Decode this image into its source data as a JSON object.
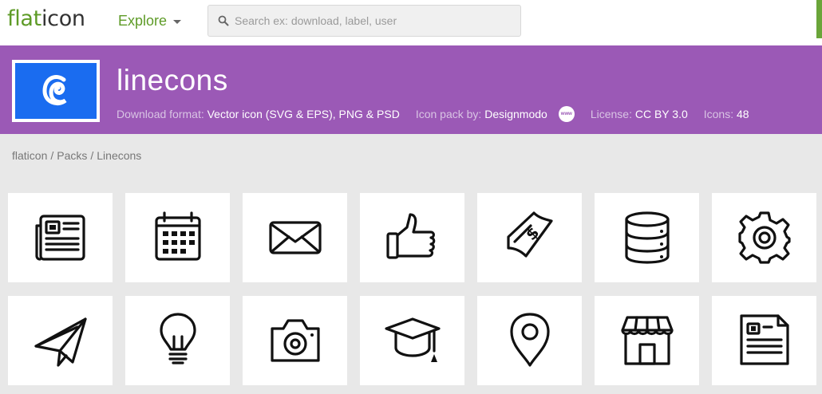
{
  "header": {
    "logo_part1": "flat",
    "logo_part2": "icon",
    "explore_label": "Explore",
    "search_placeholder": "Search ex: download, label, user"
  },
  "pack": {
    "title": "linecons",
    "format_label": "Download format:",
    "format_value": "Vector icon (SVG & EPS), PNG & PSD",
    "author_label": "Icon pack by:",
    "author_value": "Designmodo",
    "www_badge": "www",
    "license_label": "License:",
    "license_value": "CC BY 3.0",
    "count_label": "Icons:",
    "count_value": "48",
    "colors": {
      "banner": "#9b59b6",
      "logo_bg": "#1a6cf0",
      "brand_green": "#5e9b27"
    }
  },
  "breadcrumb": {
    "items": [
      "flaticon",
      "Packs",
      "Linecons"
    ],
    "separator": "/"
  },
  "icons": [
    [
      "newspaper-icon",
      "calendar-icon",
      "envelope-icon",
      "thumbs-up-icon",
      "money-bill-icon",
      "database-icon",
      "gear-icon"
    ],
    [
      "paper-plane-icon",
      "lightbulb-icon",
      "camera-icon",
      "graduation-cap-icon",
      "location-pin-icon",
      "store-icon",
      "document-icon"
    ]
  ]
}
